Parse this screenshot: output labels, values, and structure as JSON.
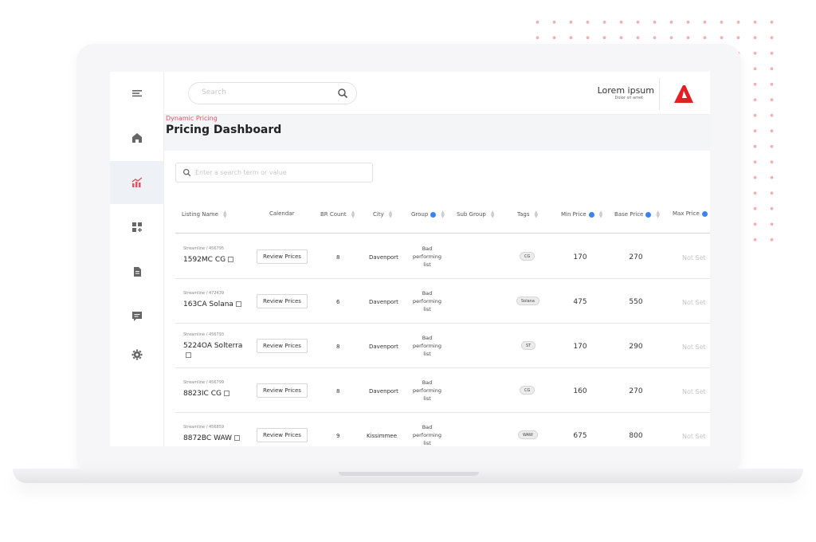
{
  "header": {
    "search_placeholder": "Search",
    "brand_title": "Lorem ipsum",
    "brand_subtitle": "Dolor sit amet"
  },
  "sidebar": {
    "items": [
      {
        "icon": "menu-icon"
      },
      {
        "icon": "home-icon"
      },
      {
        "icon": "pricing-chart-icon",
        "active": true
      },
      {
        "icon": "widgets-icon"
      },
      {
        "icon": "documents-icon"
      },
      {
        "icon": "messages-icon"
      },
      {
        "icon": "settings-icon"
      }
    ]
  },
  "page": {
    "breadcrumb": "Dynamic Pricing",
    "title": "Pricing Dashboard",
    "filter_placeholder": "Enter a search term or value"
  },
  "table": {
    "columns": [
      "Listing Name",
      "Calendar",
      "BR Count",
      "City",
      "Group",
      "Sub Group",
      "Tags",
      "Min Price",
      "Base Price",
      "Max Price"
    ],
    "review_label": "Review Prices",
    "rows": [
      {
        "source": "Streamline / 456795",
        "name": "1592MC CG",
        "br": "8",
        "city": "Davenport",
        "group": "Bad performing list",
        "tag": "CG",
        "min": "170",
        "base": "270",
        "max": "Not Set"
      },
      {
        "source": "Streamline / 472439",
        "name": "163CA Solana",
        "br": "6",
        "city": "Davenport",
        "group": "Bad performing list",
        "tag": "Solana",
        "min": "475",
        "base": "550",
        "max": "Not Set"
      },
      {
        "source": "Streamline / 456793",
        "name": "5224OA Solterra",
        "br": "8",
        "city": "Davenport",
        "group": "Bad performing list",
        "tag": "ST",
        "min": "170",
        "base": "290",
        "max": "Not Set"
      },
      {
        "source": "Streamline / 456799",
        "name": "8823IC CG",
        "br": "8",
        "city": "Davenport",
        "group": "Bad performing list",
        "tag": "CG",
        "min": "160",
        "base": "270",
        "max": "Not Set"
      },
      {
        "source": "Streamline / 456859",
        "name": "8872BC WAW",
        "br": "9",
        "city": "Kissimmee",
        "group": "Bad performing list",
        "tag": "WAW",
        "min": "675",
        "base": "800",
        "max": "Not Set"
      }
    ]
  },
  "colors": {
    "accent": "#e5535e",
    "logo": "#e31e24",
    "info": "#3b82f6",
    "active_nav": "#eef1f6"
  }
}
